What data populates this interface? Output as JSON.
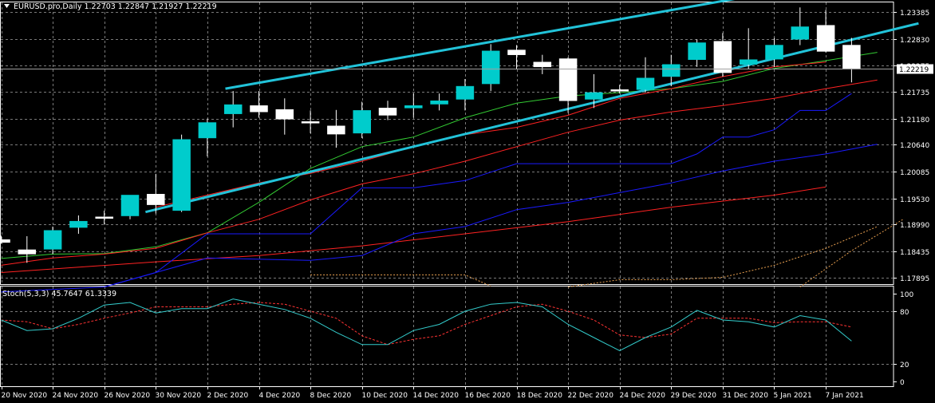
{
  "header": {
    "symbol_line": "EURUSD.pro,Daily  1.22703 1.22847 1.21927 1.22219"
  },
  "stoch_header": "Stoch(5,3,3) 45.7647 61.3339",
  "colors": {
    "background": "#000000",
    "grid": "#7a7a7a",
    "bull_candle": "#00cccc",
    "bear_candle": "#ffffff",
    "trendline": "#22c3d9",
    "ma_fast": "#33cc33",
    "ma_red": "#ff2222",
    "ma_blue": "#1a1aff",
    "envelope": "#e8a050",
    "stoch_main": "#33cccc",
    "stoch_signal": "#ff3333",
    "text": "#ffffff"
  },
  "chart_data": {
    "type": "candlestick",
    "price_axis": {
      "ylim": [
        1.1776,
        1.236
      ],
      "ticks": [
        "1.23385",
        "1.22830",
        "1.22275",
        "1.21735",
        "1.21180",
        "1.20640",
        "1.20085",
        "1.19530",
        "1.18990",
        "1.18435",
        "1.17895"
      ],
      "tick_values": [
        1.23385,
        1.2283,
        1.22275,
        1.21735,
        1.2118,
        1.2064,
        1.20085,
        1.1953,
        1.1899,
        1.18435,
        1.17895
      ],
      "current_price": "1.22219"
    },
    "x_labels": [
      "20 Nov 2020",
      "24 Nov 2020",
      "26 Nov 2020",
      "30 Nov 2020",
      "2 Dec 2020",
      "4 Dec 2020",
      "8 Dec 2020",
      "10 Dec 2020",
      "14 Dec 2020",
      "16 Dec 2020",
      "18 Dec 2020",
      "22 Dec 2020",
      "24 Dec 2020",
      "29 Dec 2020",
      "31 Dec 2020",
      "5 Jan 2021",
      "7 Jan 2021"
    ],
    "x_label_index": [
      0,
      2,
      4,
      6,
      8,
      10,
      12,
      14,
      16,
      18,
      20,
      22,
      24,
      26,
      28,
      30,
      32
    ],
    "candles": [
      {
        "o": 1.1868,
        "h": 1.1876,
        "l": 1.186,
        "c": 1.1862
      },
      {
        "o": 1.1847,
        "h": 1.1875,
        "l": 1.182,
        "c": 1.1838
      },
      {
        "o": 1.1848,
        "h": 1.1895,
        "l": 1.1838,
        "c": 1.1887
      },
      {
        "o": 1.1893,
        "h": 1.1918,
        "l": 1.188,
        "c": 1.1906
      },
      {
        "o": 1.1915,
        "h": 1.1928,
        "l": 1.19,
        "c": 1.1912
      },
      {
        "o": 1.1917,
        "h": 1.196,
        "l": 1.191,
        "c": 1.196
      },
      {
        "o": 1.1962,
        "h": 1.2004,
        "l": 1.1922,
        "c": 1.194
      },
      {
        "o": 1.1928,
        "h": 1.2085,
        "l": 1.1925,
        "c": 1.2075
      },
      {
        "o": 1.2078,
        "h": 1.2118,
        "l": 1.204,
        "c": 1.211
      },
      {
        "o": 1.2128,
        "h": 1.2175,
        "l": 1.21,
        "c": 1.2147
      },
      {
        "o": 1.2145,
        "h": 1.2175,
        "l": 1.212,
        "c": 1.2132
      },
      {
        "o": 1.2137,
        "h": 1.216,
        "l": 1.2085,
        "c": 1.2117
      },
      {
        "o": 1.2112,
        "h": 1.2135,
        "l": 1.2088,
        "c": 1.2109
      },
      {
        "o": 1.2103,
        "h": 1.2136,
        "l": 1.2058,
        "c": 1.2086
      },
      {
        "o": 1.2088,
        "h": 1.2153,
        "l": 1.2078,
        "c": 1.2135
      },
      {
        "o": 1.214,
        "h": 1.2155,
        "l": 1.2115,
        "c": 1.2125
      },
      {
        "o": 1.214,
        "h": 1.2171,
        "l": 1.212,
        "c": 1.2145
      },
      {
        "o": 1.2148,
        "h": 1.217,
        "l": 1.2135,
        "c": 1.2155
      },
      {
        "o": 1.2158,
        "h": 1.22,
        "l": 1.2135,
        "c": 1.2185
      },
      {
        "o": 1.219,
        "h": 1.2272,
        "l": 1.2175,
        "c": 1.2258
      },
      {
        "o": 1.226,
        "h": 1.227,
        "l": 1.222,
        "c": 1.225
      },
      {
        "o": 1.2235,
        "h": 1.225,
        "l": 1.221,
        "c": 1.2225
      },
      {
        "o": 1.2242,
        "h": 1.2245,
        "l": 1.213,
        "c": 1.2155
      },
      {
        "o": 1.2158,
        "h": 1.221,
        "l": 1.214,
        "c": 1.2172
      },
      {
        "o": 1.2178,
        "h": 1.2188,
        "l": 1.217,
        "c": 1.2175
      },
      {
        "o": 1.2178,
        "h": 1.2245,
        "l": 1.2172,
        "c": 1.2202
      },
      {
        "o": 1.2205,
        "h": 1.225,
        "l": 1.2185,
        "c": 1.223
      },
      {
        "o": 1.224,
        "h": 1.2282,
        "l": 1.2225,
        "c": 1.2275
      },
      {
        "o": 1.2278,
        "h": 1.2295,
        "l": 1.2205,
        "c": 1.2213
      },
      {
        "o": 1.223,
        "h": 1.2305,
        "l": 1.222,
        "c": 1.224
      },
      {
        "o": 1.2241,
        "h": 1.2285,
        "l": 1.2225,
        "c": 1.227
      },
      {
        "o": 1.2282,
        "h": 1.2348,
        "l": 1.227,
        "c": 1.2308
      },
      {
        "o": 1.2311,
        "h": 1.2343,
        "l": 1.2255,
        "c": 1.2257
      },
      {
        "o": 1.227,
        "h": 1.2285,
        "l": 1.2193,
        "c": 1.2222
      }
    ],
    "trendlines": [
      {
        "from": [
          8.7,
          1.218
        ],
        "to": [
          30.0,
          1.238
        ]
      },
      {
        "from": [
          5.6,
          1.1925
        ],
        "to": [
          35.6,
          1.2315
        ]
      }
    ],
    "indicator_lines": [
      {
        "color_key": "ma_fast",
        "points": [
          [
            0,
            1.1829
          ],
          [
            2,
            1.1838
          ],
          [
            4,
            1.1839
          ],
          [
            6,
            1.1853
          ],
          [
            8,
            1.1882
          ],
          [
            10,
            1.1945
          ],
          [
            12,
            1.2015
          ],
          [
            14,
            1.206
          ],
          [
            16,
            1.208
          ],
          [
            18,
            1.212
          ],
          [
            20,
            1.215
          ],
          [
            22,
            1.2165
          ],
          [
            24,
            1.2172
          ],
          [
            26,
            1.218
          ],
          [
            28,
            1.2195
          ],
          [
            30,
            1.2222
          ],
          [
            32,
            1.2238
          ],
          [
            34,
            1.2255
          ]
        ]
      },
      {
        "color_key": "ma_red",
        "points": [
          [
            0,
            1.1815
          ],
          [
            2,
            1.183
          ],
          [
            4,
            1.1838
          ],
          [
            6,
            1.185
          ],
          [
            8,
            1.1882
          ],
          [
            10,
            1.191
          ],
          [
            12,
            1.195
          ],
          [
            14,
            1.1983
          ],
          [
            16,
            1.2004
          ],
          [
            18,
            1.203
          ],
          [
            20,
            1.206
          ],
          [
            22,
            1.209
          ],
          [
            24,
            1.2115
          ],
          [
            26,
            1.2132
          ],
          [
            28,
            1.2145
          ],
          [
            30,
            1.216
          ],
          [
            32,
            1.218
          ],
          [
            34,
            1.2198
          ]
        ]
      },
      {
        "color_key": "ma_red",
        "points": [
          [
            0,
            1.18
          ],
          [
            6,
            1.1822
          ],
          [
            10,
            1.1835
          ],
          [
            14,
            1.1855
          ],
          [
            18,
            1.188
          ],
          [
            22,
            1.1905
          ],
          [
            26,
            1.1935
          ],
          [
            30,
            1.196
          ],
          [
            32,
            1.1977
          ]
        ]
      },
      {
        "color_key": "ma_red",
        "points": [
          [
            6,
            1.1935
          ],
          [
            8,
            1.196
          ],
          [
            10,
            1.1985
          ],
          [
            12,
            1.2005
          ],
          [
            14,
            1.203
          ],
          [
            16,
            1.206
          ],
          [
            18,
            1.2085
          ],
          [
            20,
            1.21
          ],
          [
            22,
            1.2125
          ],
          [
            24,
            1.216
          ],
          [
            26,
            1.218
          ],
          [
            28,
            1.2205
          ],
          [
            30,
            1.2225
          ],
          [
            32,
            1.2235
          ]
        ]
      },
      {
        "color_key": "ma_blue",
        "points": [
          [
            0,
            1.176
          ],
          [
            4,
            1.177
          ],
          [
            6,
            1.18
          ],
          [
            8,
            1.183
          ],
          [
            12,
            1.1825
          ],
          [
            14,
            1.1835
          ],
          [
            16,
            1.188
          ],
          [
            18,
            1.1895
          ],
          [
            20,
            1.193
          ],
          [
            22,
            1.1945
          ],
          [
            24,
            1.1965
          ],
          [
            26,
            1.1985
          ],
          [
            28,
            1.201
          ],
          [
            30,
            1.203
          ],
          [
            32,
            1.2045
          ],
          [
            34,
            1.2065
          ]
        ]
      },
      {
        "color_key": "ma_blue",
        "points": [
          [
            4,
            1.177
          ],
          [
            6,
            1.18
          ],
          [
            8,
            1.188
          ],
          [
            10,
            1.188
          ],
          [
            12,
            1.188
          ],
          [
            14,
            1.1975
          ],
          [
            16,
            1.1975
          ],
          [
            18,
            1.199
          ],
          [
            20,
            1.2025
          ],
          [
            22,
            1.2025
          ],
          [
            24,
            1.2025
          ],
          [
            26,
            1.2025
          ],
          [
            27,
            1.2045
          ],
          [
            28,
            1.208
          ],
          [
            29,
            1.208
          ],
          [
            30,
            1.2095
          ],
          [
            31,
            1.2135
          ],
          [
            32,
            1.2135
          ],
          [
            33,
            1.217
          ]
        ]
      }
    ],
    "envelope_lines": [
      {
        "points": [
          [
            12,
            1.1795
          ],
          [
            18,
            1.1795
          ],
          [
            19,
            1.1772
          ]
        ]
      },
      {
        "points": [
          [
            22,
            1.177
          ],
          [
            24,
            1.1785
          ],
          [
            26,
            1.1785
          ],
          [
            28,
            1.179
          ],
          [
            30,
            1.1815
          ],
          [
            32,
            1.185
          ],
          [
            34,
            1.1895
          ]
        ]
      },
      {
        "points": [
          [
            31,
            1.177
          ],
          [
            33,
            1.1845
          ],
          [
            35,
            1.191
          ]
        ]
      }
    ],
    "stochastic": {
      "title": "Stoch(5,3,3) 45.7647 61.3339",
      "ylim": [
        0,
        100
      ],
      "ticks": [
        "100",
        "80",
        "20",
        "0"
      ],
      "tick_values": [
        100,
        80,
        20,
        0
      ],
      "main": [
        70,
        58,
        60,
        72,
        87,
        90,
        78,
        83,
        83,
        94,
        88,
        82,
        72,
        56,
        42,
        42,
        58,
        65,
        80,
        88,
        90,
        85,
        65,
        50,
        35,
        50,
        62,
        81,
        70,
        68,
        62,
        75,
        70,
        46
      ],
      "signal": [
        70,
        68,
        60,
        65,
        72,
        78,
        85,
        85,
        85,
        88,
        90,
        88,
        80,
        72,
        52,
        42,
        48,
        52,
        65,
        75,
        85,
        88,
        80,
        70,
        53,
        50,
        54,
        72,
        72,
        72,
        67,
        68,
        68,
        62
      ]
    }
  }
}
